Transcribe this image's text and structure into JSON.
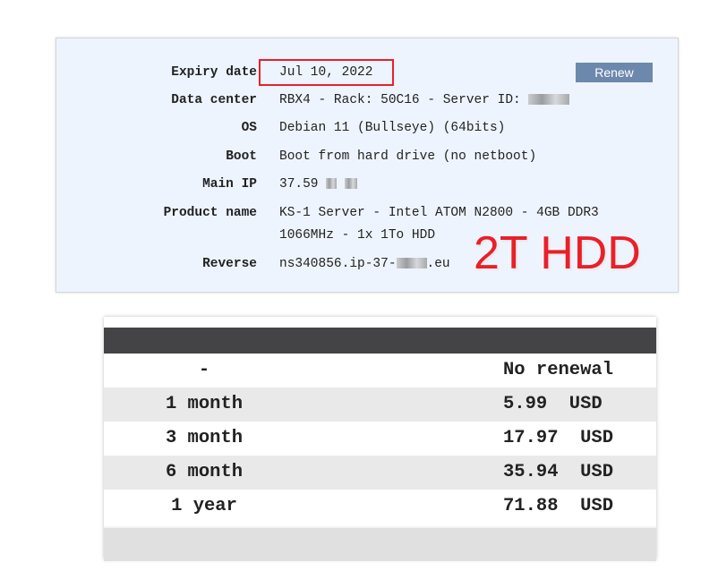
{
  "server_info": {
    "rows": [
      {
        "label": "Expiry date",
        "value": "Jul 10, 2022"
      },
      {
        "label": "Data center",
        "value": "RBX4 - Rack: 50C16 - Server ID: "
      },
      {
        "label": "OS",
        "value": "Debian 11 (Bullseye) (64bits)"
      },
      {
        "label": "Boot",
        "value": "Boot from hard drive (no netboot)"
      },
      {
        "label": "Main IP",
        "value": "37.59"
      },
      {
        "label": "Product name",
        "value": "KS-1 Server - Intel ATOM N2800 - 4GB DDR3",
        "value2": "1066MHz - 1x 1To HDD"
      },
      {
        "label": "Reverse",
        "value": "ns340856.ip-37-",
        "value_suffix": ".eu"
      }
    ],
    "renew_label": "Renew",
    "annotation": "2T HDD",
    "highlight_color": "#e8202a",
    "button_color": "#6d88ad"
  },
  "renewal_table": {
    "rows": [
      {
        "duration": "-",
        "price": "No renewal"
      },
      {
        "duration": "1 month",
        "price": "5.99  USD"
      },
      {
        "duration": "3 month",
        "price": "17.97  USD"
      },
      {
        "duration": "6 month",
        "price": "35.94  USD"
      },
      {
        "duration": "1 year",
        "price": "71.88  USD"
      }
    ]
  }
}
